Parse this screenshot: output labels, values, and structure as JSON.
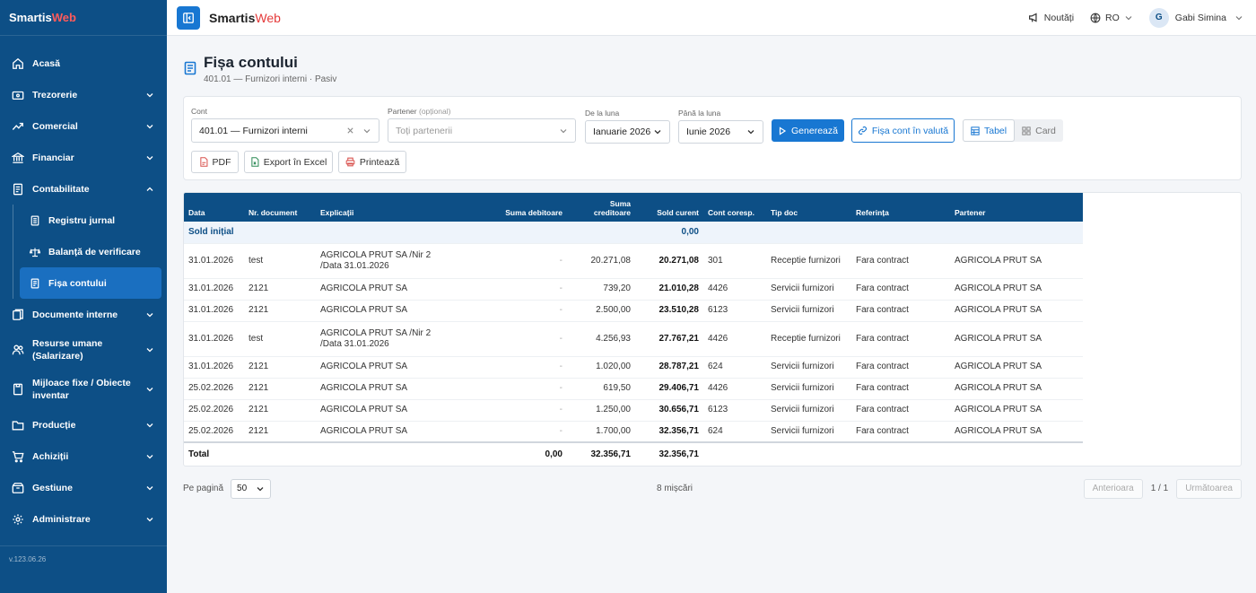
{
  "brand": {
    "part1": "Smartis",
    "part2": "Web"
  },
  "sidebar": {
    "items": [
      {
        "label": "Acasă",
        "icon": "home-icon"
      },
      {
        "label": "Trezorerie",
        "icon": "wallet-icon"
      },
      {
        "label": "Comercial",
        "icon": "trend-icon"
      },
      {
        "label": "Financiar",
        "icon": "bank-icon"
      },
      {
        "label": "Contabilitate",
        "icon": "ledger-icon"
      },
      {
        "label": "Documente interne",
        "icon": "documents-icon"
      },
      {
        "label": "Resurse umane (Salarizare)",
        "icon": "people-icon"
      },
      {
        "label": "Mijloace fixe / Obiecte inventar",
        "icon": "inventory-icon"
      },
      {
        "label": "Producție",
        "icon": "folder-icon"
      },
      {
        "label": "Achiziții",
        "icon": "cart-icon"
      },
      {
        "label": "Gestiune",
        "icon": "box-icon"
      },
      {
        "label": "Administrare",
        "icon": "gear-icon"
      }
    ],
    "sub_items": [
      {
        "label": "Registru jurnal",
        "icon": "journal-icon"
      },
      {
        "label": "Balanță de verificare",
        "icon": "scale-icon"
      },
      {
        "label": "Fișa contului",
        "icon": "sheet-icon",
        "active": true
      }
    ],
    "version": "v.123.06.26"
  },
  "topbar": {
    "news": "Noutăți",
    "lang": "RO",
    "user_initial": "G",
    "user_name": "Gabi Simina"
  },
  "page": {
    "title": "Fișa contului",
    "subtitle": "401.01 — Furnizori interni · Pasiv"
  },
  "filters": {
    "cont_label": "Cont",
    "cont_value": "401.01 — Furnizori interni",
    "partener_label": "Partener",
    "partener_optional": "(opțional)",
    "partener_placeholder": "Toți partenerii",
    "from_label": "De la luna",
    "from_value": "Ianuarie 2026",
    "to_label": "Până la luna",
    "to_value": "Iunie 2026",
    "generate": "Generează",
    "currency": "Fișa cont în valută",
    "view_table": "Tabel",
    "view_card": "Card",
    "pdf": "PDF",
    "excel": "Export în Excel",
    "print": "Printează"
  },
  "table": {
    "headers": [
      "Data",
      "Nr. document",
      "Explicații",
      "Suma debitoare",
      "Suma creditoare",
      "Sold curent",
      "Cont coresp.",
      "Tip doc",
      "Referința",
      "Partener"
    ],
    "sold_initial": {
      "label": "Sold inițial",
      "value": "0,00"
    },
    "rows": [
      {
        "data": "31.01.2026",
        "doc": "test",
        "expl": "AGRICOLA PRUT SA /Nir 2 /Data 31.01.2026",
        "deb": "-",
        "cred": "20.271,08",
        "sold": "20.271,08",
        "cont": "301",
        "tip": "Receptie furnizori",
        "ref": "Fara contract",
        "part": "AGRICOLA PRUT SA"
      },
      {
        "data": "31.01.2026",
        "doc": "2121",
        "expl": "AGRICOLA PRUT SA",
        "deb": "-",
        "cred": "739,20",
        "sold": "21.010,28",
        "cont": "4426",
        "tip": "Servicii furnizori",
        "ref": "Fara contract",
        "part": "AGRICOLA PRUT SA"
      },
      {
        "data": "31.01.2026",
        "doc": "2121",
        "expl": "AGRICOLA PRUT SA",
        "deb": "-",
        "cred": "2.500,00",
        "sold": "23.510,28",
        "cont": "6123",
        "tip": "Servicii furnizori",
        "ref": "Fara contract",
        "part": "AGRICOLA PRUT SA"
      },
      {
        "data": "31.01.2026",
        "doc": "test",
        "expl": "AGRICOLA PRUT SA /Nir 2 /Data 31.01.2026",
        "deb": "-",
        "cred": "4.256,93",
        "sold": "27.767,21",
        "cont": "4426",
        "tip": "Receptie furnizori",
        "ref": "Fara contract",
        "part": "AGRICOLA PRUT SA"
      },
      {
        "data": "31.01.2026",
        "doc": "2121",
        "expl": "AGRICOLA PRUT SA",
        "deb": "-",
        "cred": "1.020,00",
        "sold": "28.787,21",
        "cont": "624",
        "tip": "Servicii furnizori",
        "ref": "Fara contract",
        "part": "AGRICOLA PRUT SA"
      },
      {
        "data": "25.02.2026",
        "doc": "2121",
        "expl": "AGRICOLA PRUT SA",
        "deb": "-",
        "cred": "619,50",
        "sold": "29.406,71",
        "cont": "4426",
        "tip": "Servicii furnizori",
        "ref": "Fara contract",
        "part": "AGRICOLA PRUT SA"
      },
      {
        "data": "25.02.2026",
        "doc": "2121",
        "expl": "AGRICOLA PRUT SA",
        "deb": "-",
        "cred": "1.250,00",
        "sold": "30.656,71",
        "cont": "6123",
        "tip": "Servicii furnizori",
        "ref": "Fara contract",
        "part": "AGRICOLA PRUT SA"
      },
      {
        "data": "25.02.2026",
        "doc": "2121",
        "expl": "AGRICOLA PRUT SA",
        "deb": "-",
        "cred": "1.700,00",
        "sold": "32.356,71",
        "cont": "624",
        "tip": "Servicii furnizori",
        "ref": "Fara contract",
        "part": "AGRICOLA PRUT SA"
      }
    ],
    "total": {
      "label": "Total",
      "deb": "0,00",
      "cred": "32.356,71",
      "sold": "32.356,71"
    }
  },
  "pagination": {
    "per_page_label": "Pe pagină",
    "per_page": "50",
    "count": "8 mișcări",
    "prev": "Anterioara",
    "page_info": "1 / 1",
    "next": "Următoarea"
  }
}
